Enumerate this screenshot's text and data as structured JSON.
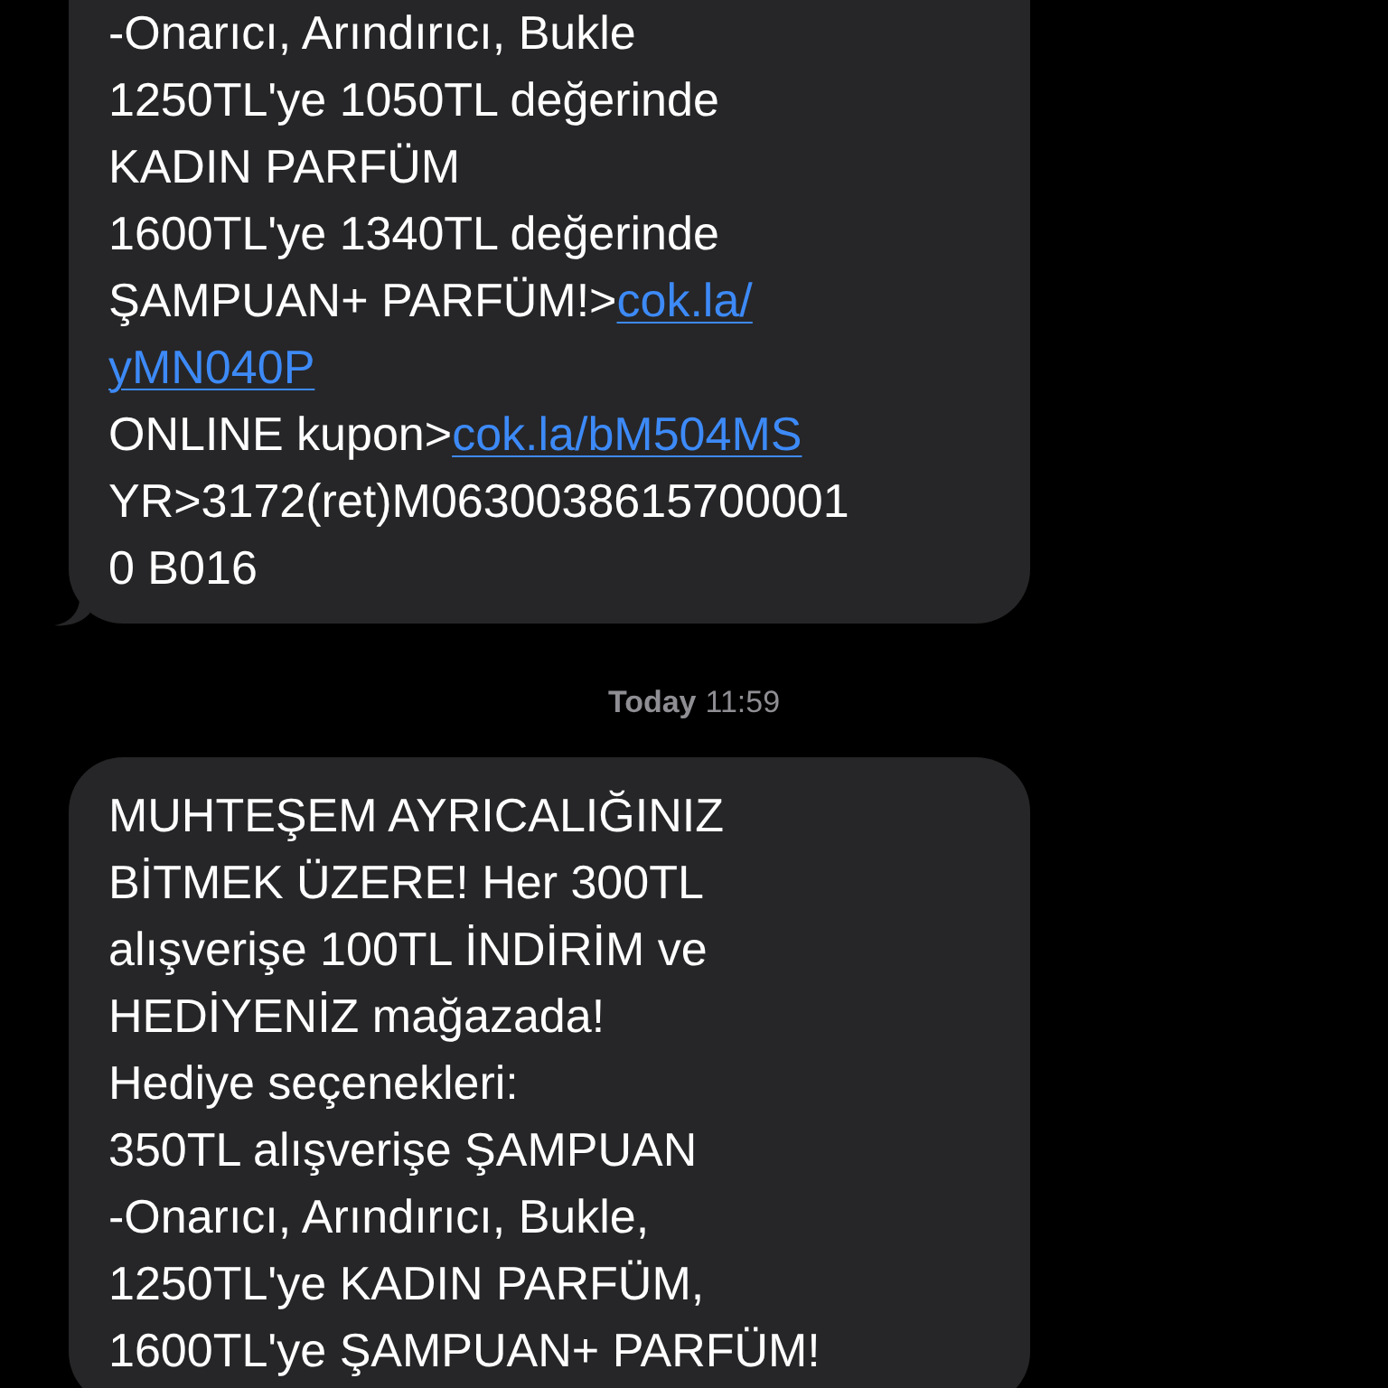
{
  "messages": [
    {
      "tail": true,
      "lines": [
        [
          {
            "kind": "text",
            "text": "-Onarıcı, Arındırıcı, Bukle"
          }
        ],
        [
          {
            "kind": "text",
            "text": "1250TL'ye 1050TL değerinde"
          }
        ],
        [
          {
            "kind": "text",
            "text": "KADIN PARFÜM"
          }
        ],
        [
          {
            "kind": "text",
            "text": "1600TL'ye 1340TL değerinde"
          }
        ],
        [
          {
            "kind": "text",
            "text": "ŞAMPUAN+ PARFÜM!>"
          },
          {
            "kind": "link",
            "text": "cok.la/"
          }
        ],
        [
          {
            "kind": "link",
            "text": "yMN040P"
          }
        ],
        [
          {
            "kind": "text",
            "text": "ONLINE kupon>"
          },
          {
            "kind": "link",
            "text": "cok.la/bM504MS"
          }
        ],
        [
          {
            "kind": "text",
            "text": "YR>3172(ret)M0630038615700001"
          }
        ],
        [
          {
            "kind": "text",
            "text": "0 B016"
          }
        ]
      ]
    },
    {
      "timestamp": {
        "day": "Today",
        "time": "11:59"
      },
      "tail": false,
      "lines": [
        [
          {
            "kind": "text",
            "text": "MUHTEŞEM AYRICALIĞINIZ"
          }
        ],
        [
          {
            "kind": "text",
            "text": "BİTMEK ÜZERE! Her 300TL"
          }
        ],
        [
          {
            "kind": "text",
            "text": "alışverişe 100TL İNDİRİM ve"
          }
        ],
        [
          {
            "kind": "text",
            "text": "HEDİYENİZ mağazada!"
          }
        ],
        [
          {
            "kind": "text",
            "text": "Hediye seçenekleri:"
          }
        ],
        [
          {
            "kind": "text",
            "text": "350TL alışverişe ŞAMPUAN"
          }
        ],
        [
          {
            "kind": "text",
            "text": "-Onarıcı, Arındırıcı, Bukle,"
          }
        ],
        [
          {
            "kind": "text",
            "text": "1250TL'ye KADIN PARFÜM,"
          }
        ],
        [
          {
            "kind": "text",
            "text": "1600TL'ye ŞAMPUAN+ PARFÜM!"
          }
        ]
      ]
    }
  ]
}
